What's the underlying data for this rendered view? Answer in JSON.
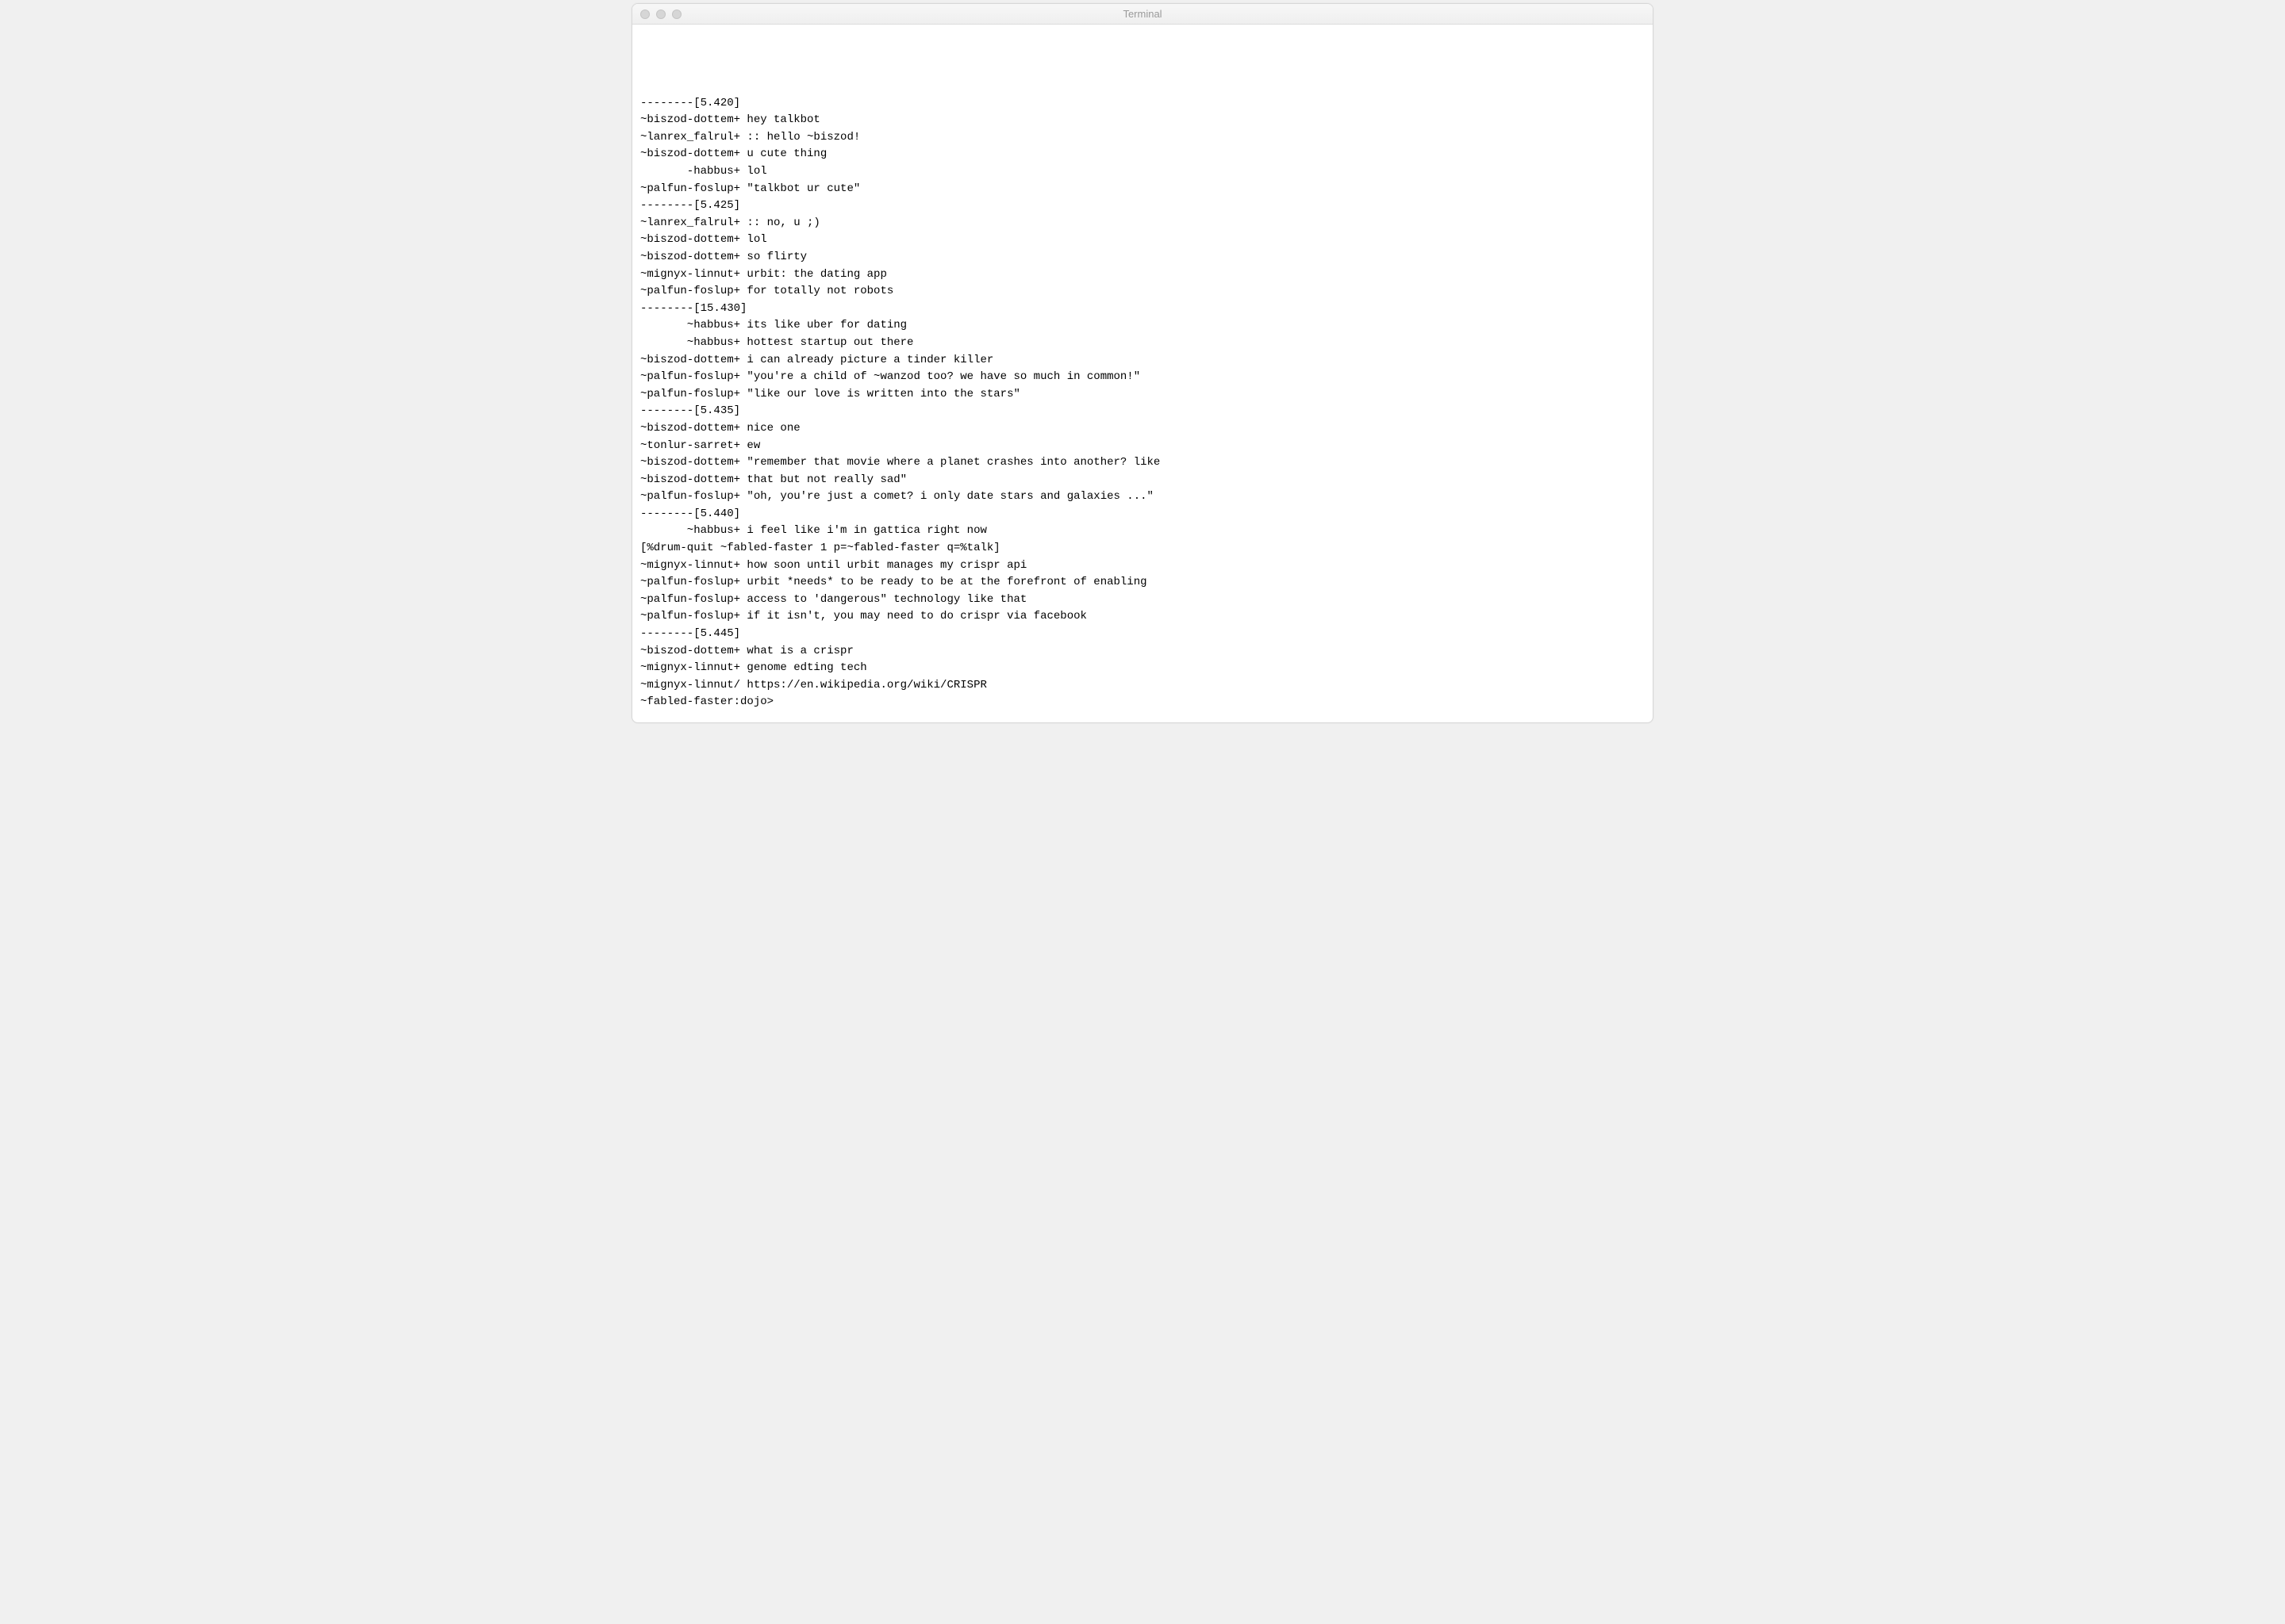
{
  "window": {
    "title": "Terminal"
  },
  "terminal": {
    "lines": [
      "--------[5.420]",
      "~biszod-dottem+ hey talkbot",
      "~lanrex_falrul+ :: hello ~biszod!",
      "~biszod-dottem+ u cute thing",
      "       -habbus+ lol",
      "~palfun-foslup+ \"talkbot ur cute\"",
      "--------[5.425]",
      "~lanrex_falrul+ :: no, u ;)",
      "~biszod-dottem+ lol",
      "~biszod-dottem+ so flirty",
      "~mignyx-linnut+ urbit: the dating app",
      "~palfun-foslup+ for totally not robots",
      "--------[15.430]",
      "       ~habbus+ its like uber for dating",
      "       ~habbus+ hottest startup out there",
      "~biszod-dottem+ i can already picture a tinder killer",
      "~palfun-foslup+ \"you're a child of ~wanzod too? we have so much in common!\"",
      "~palfun-foslup+ \"like our love is written into the stars\"",
      "--------[5.435]",
      "~biszod-dottem+ nice one",
      "~tonlur-sarret+ ew",
      "~biszod-dottem+ \"remember that movie where a planet crashes into another? like",
      "~biszod-dottem+ that but not really sad\"",
      "~palfun-foslup+ \"oh, you're just a comet? i only date stars and galaxies ...\"",
      "--------[5.440]",
      "       ~habbus+ i feel like i'm in gattica right now",
      "[%drum-quit ~fabled-faster 1 p=~fabled-faster q=%talk]",
      "~mignyx-linnut+ how soon until urbit manages my crispr api",
      "~palfun-foslup+ urbit *needs* to be ready to be at the forefront of enabling",
      "~palfun-foslup+ access to 'dangerous\" technology like that",
      "~palfun-foslup+ if it isn't, you may need to do crispr via facebook",
      "--------[5.445]",
      "~biszod-dottem+ what is a crispr",
      "~mignyx-linnut+ genome edting tech",
      "~mignyx-linnut/ https://en.wikipedia.org/wiki/CRISPR"
    ],
    "prompt": "~fabled-faster:dojo> "
  }
}
